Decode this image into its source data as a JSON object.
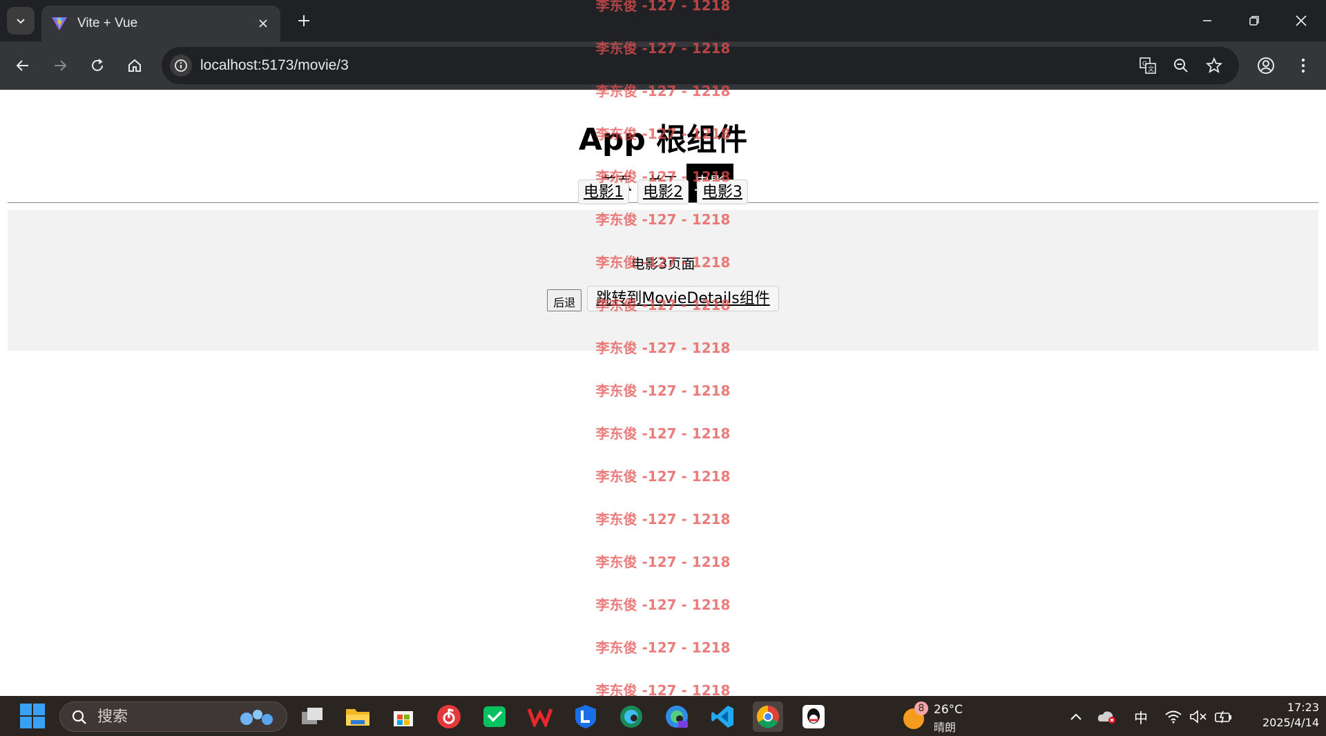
{
  "browser": {
    "tab_title": "Vite + Vue",
    "url": "localhost:5173/movie/3"
  },
  "page": {
    "app_title": "App 根组件",
    "nav": [
      {
        "label": "首页",
        "active": false
      },
      {
        "label": "关于",
        "active": false
      },
      {
        "label": "电影",
        "active": true
      }
    ],
    "sub_nav": [
      {
        "label": "电影1"
      },
      {
        "label": "电影2"
      },
      {
        "label": "电影3"
      }
    ],
    "page_text": "电影3页面",
    "back_button": "后退",
    "jump_button": "跳转到MovieDetails组件",
    "watermark_text": "李东俊 -127 - 1218"
  },
  "taskbar": {
    "search_label": "搜索",
    "weather_badge": "8",
    "temperature": "26°C",
    "weather_condition": "晴朗",
    "ime": "中",
    "time": "17:23",
    "date": "2025/4/14"
  },
  "colors": {
    "watermark": "#e65050",
    "active_nav_bg": "#000000",
    "chrome_dark": "#202124",
    "chrome_toolbar": "#35363a"
  }
}
